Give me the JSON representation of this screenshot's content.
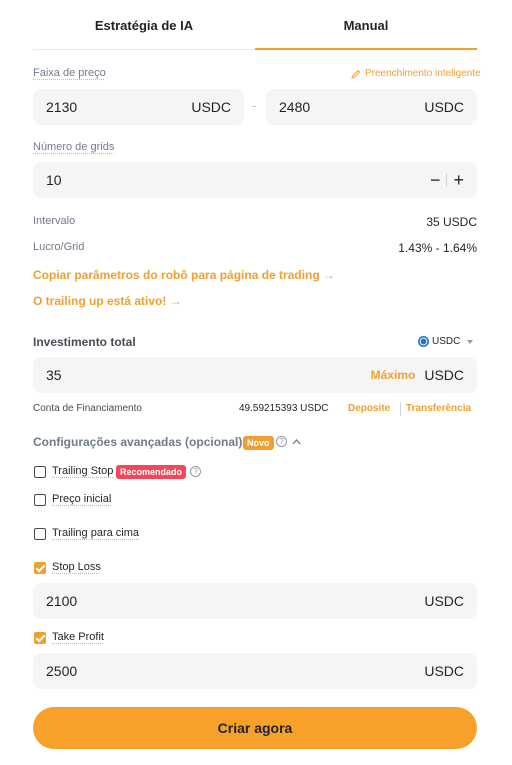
{
  "tabs": [
    {
      "label": "Estratégia de IA",
      "active": false
    },
    {
      "label": "Manual",
      "active": true
    }
  ],
  "price_range": {
    "label": "Faixa de preço",
    "smart_fill": "Preenchimento inteligente",
    "low": "2130",
    "high": "2480",
    "unit": "USDC",
    "separator": "-"
  },
  "grids": {
    "label": "Número de grids",
    "value": "10",
    "minus": "−",
    "plus": "+"
  },
  "stats": {
    "interval_label": "Intervalo",
    "interval_value": "35 USDC",
    "profit_label": "Lucro/Grid",
    "profit_value": "1.43% - 1.64%"
  },
  "links": {
    "copy_params": "Copiar parâmetros do robô para página de trading →",
    "trailing_active": "O trailing up está ativo! →"
  },
  "investment": {
    "label": "Investimento total",
    "currency": "USDC",
    "value": "35",
    "max": "Máximo",
    "unit": "USDC"
  },
  "funding": {
    "label": "Conta de Financiamento",
    "value": "49.59215393 USDC",
    "deposit": "Deposite",
    "transfer": "Transferência"
  },
  "advanced": {
    "label": "Configurações avançadas (opcional)",
    "badge": "Novo",
    "options": [
      {
        "label": "Trailing Stop",
        "checked": false,
        "badge": "Recomendado"
      },
      {
        "label": "Preço inicial",
        "checked": false
      },
      {
        "label": "Trailing para cima",
        "checked": false
      },
      {
        "label": "Stop Loss",
        "checked": true
      },
      {
        "label": "Take Profit",
        "checked": true
      }
    ],
    "stop_loss": {
      "value": "2100",
      "unit": "USDC"
    },
    "take_profit": {
      "value": "2500",
      "unit": "USDC"
    }
  },
  "create_button": "Criar agora",
  "colors": {
    "accent": "#f0a030",
    "button": "#f7a02a",
    "badge_new": "#f0a030",
    "badge_recommended": "#f6465d",
    "field_bg": "#f5f5f5",
    "usdc_icon": "#2775ca"
  }
}
